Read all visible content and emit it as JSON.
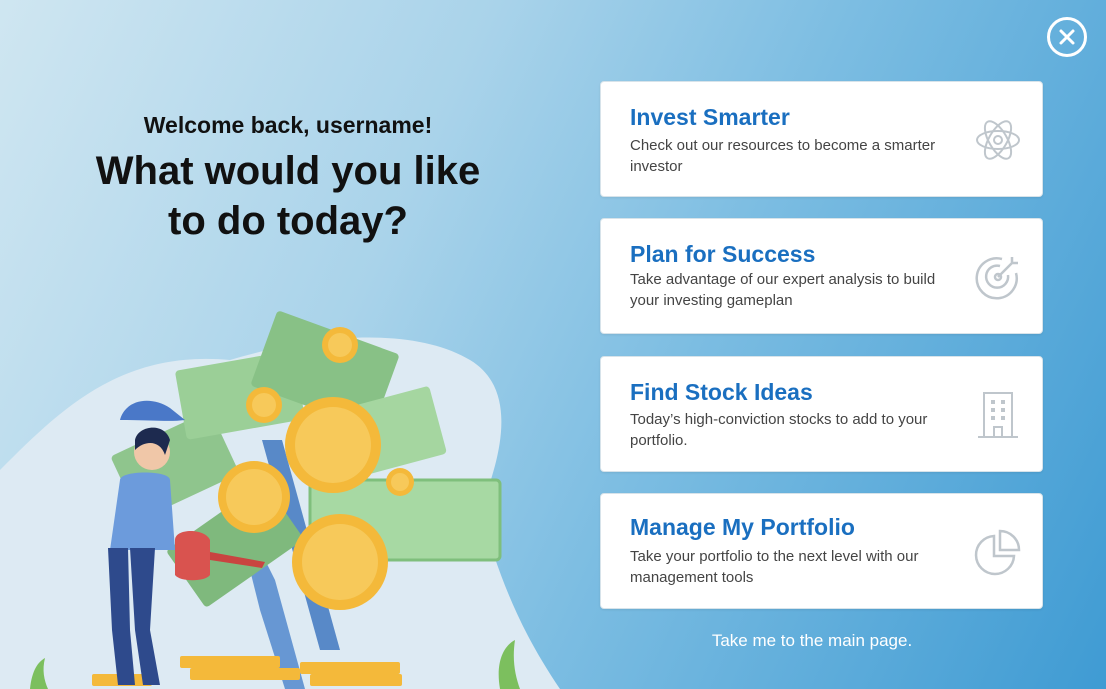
{
  "welcome": {
    "greeting": "Welcome back, username!",
    "question_line1": "What would you like",
    "question_line2": "to do today?"
  },
  "cards": [
    {
      "title": "Invest Smarter",
      "description": "Check out our resources to become a smarter investor",
      "icon": "atom-icon"
    },
    {
      "title": "Plan for Success",
      "description": "Take advantage of our expert analysis to build your investing gameplan",
      "icon": "target-icon"
    },
    {
      "title": "Find Stock Ideas",
      "description": "Today’s high-conviction stocks to add to your portfolio.",
      "icon": "building-icon"
    },
    {
      "title": "Manage My Portfolio",
      "description": "Take your portfolio to the next level with our management tools",
      "icon": "pie-chart-icon"
    }
  ],
  "footer": {
    "main_page_link": "Take me to the main page."
  },
  "colors": {
    "accent": "#1a6fc0",
    "background_start": "#cfe6f1",
    "background_end": "#3f9bd3"
  }
}
